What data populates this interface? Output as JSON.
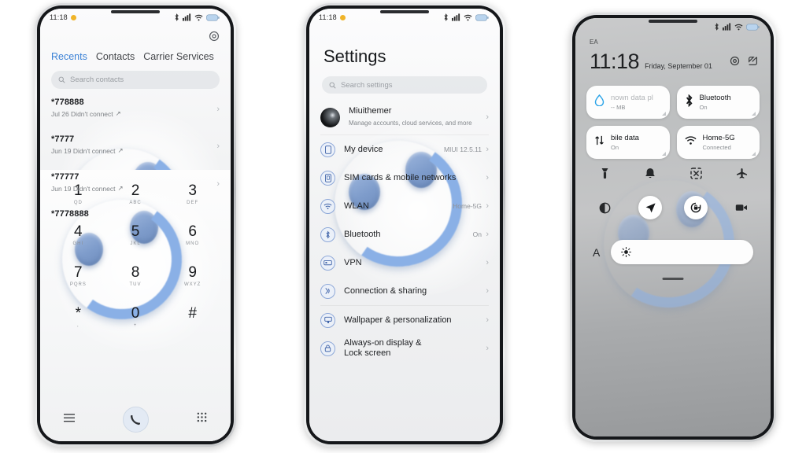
{
  "scene": {
    "background": "#ffffff",
    "accent_blue": "#3b82d6",
    "wallpaper_blue": "#8ab0e6"
  },
  "phone1": {
    "name": "dialer-phone",
    "status_bar": {
      "time": "11:18",
      "icons": [
        "amber-dot-icon",
        "bluetooth-icon",
        "signal-icon",
        "wifi-icon",
        "battery-icon"
      ]
    },
    "settings_icon": "gear-icon",
    "tabs": [
      {
        "label": "Recents",
        "active": true
      },
      {
        "label": "Contacts",
        "active": false
      },
      {
        "label": "Carrier Services",
        "active": false
      }
    ],
    "search": {
      "placeholder": "Search contacts",
      "icon": "search-icon"
    },
    "calls": [
      {
        "number": "*778888",
        "meta": "Jul 26 Didn't connect"
      },
      {
        "number": "*7777",
        "meta": "Jun 19 Didn't connect"
      },
      {
        "number": "*77777",
        "meta": "Jun 19 Didn't connect"
      },
      {
        "number": "*7778888",
        "meta": ""
      }
    ],
    "keypad": [
      {
        "digit": "1",
        "letters": "QD"
      },
      {
        "digit": "2",
        "letters": "ABC"
      },
      {
        "digit": "3",
        "letters": "DEF"
      },
      {
        "digit": "4",
        "letters": "GHI"
      },
      {
        "digit": "5",
        "letters": "JKL"
      },
      {
        "digit": "6",
        "letters": "MNO"
      },
      {
        "digit": "7",
        "letters": "PQRS"
      },
      {
        "digit": "8",
        "letters": "TUV"
      },
      {
        "digit": "9",
        "letters": "WXYZ"
      },
      {
        "digit": "*",
        "letters": ","
      },
      {
        "digit": "0",
        "letters": "+"
      },
      {
        "digit": "#",
        "letters": ""
      }
    ],
    "bottom_bar": {
      "menu_icon": "menu-icon",
      "call_icon": "phone-call-icon",
      "keypad_icon": "keypad-icon"
    }
  },
  "phone2": {
    "name": "settings-phone",
    "status_bar": {
      "time": "11:18",
      "icons": [
        "amber-dot-icon",
        "bluetooth-icon",
        "signal-icon",
        "wifi-icon",
        "battery-icon"
      ]
    },
    "title": "Settings",
    "search": {
      "placeholder": "Search settings",
      "icon": "search-icon"
    },
    "account": {
      "name": "Miuithemer",
      "subtitle": "Manage accounts, cloud services, and more",
      "avatar": "profile-avatar"
    },
    "items": [
      {
        "label": "My device",
        "value": "MIUI 12.5.11",
        "icon": "phone-icon"
      },
      {
        "label": "SIM cards & mobile networks",
        "value": "",
        "icon": "sim-card-icon"
      },
      {
        "label": "WLAN",
        "value": "Home-5G",
        "icon": "wifi-icon"
      },
      {
        "label": "Bluetooth",
        "value": "On",
        "icon": "bluetooth-icon"
      },
      {
        "label": "VPN",
        "value": "",
        "icon": "vpn-icon"
      },
      {
        "label": "Connection & sharing",
        "value": "",
        "icon": "connection-sharing-icon"
      },
      {
        "label": "Wallpaper & personalization",
        "value": "",
        "icon": "wallpaper-icon"
      },
      {
        "label": "Always-on display & Lock screen",
        "value": "",
        "icon": "lock-icon"
      }
    ]
  },
  "phone3": {
    "name": "control-center-phone",
    "carrier": "EA",
    "status_icons": [
      "bluetooth-icon",
      "signal-icon",
      "wifi-icon",
      "battery-icon"
    ],
    "time": "11:18",
    "date": "Friday, September 01",
    "header_icons": [
      "gear-icon",
      "edit-icon"
    ],
    "tiles": [
      {
        "title": "nown data pl",
        "subtitle": "-- MB",
        "icon": "data-drop-icon",
        "state": "off"
      },
      {
        "title": "Bluetooth",
        "subtitle": "On",
        "icon": "bluetooth-icon",
        "state": "on"
      },
      {
        "title": "bile data",
        "subtitle": "On",
        "icon": "mobile-data-icon",
        "state": "on"
      },
      {
        "title": "Home-5G",
        "subtitle": "Connected",
        "icon": "wifi-icon",
        "state": "on"
      }
    ],
    "toggles_row1": [
      {
        "icon": "flashlight-icon",
        "active": false
      },
      {
        "icon": "bell-icon",
        "active": false
      },
      {
        "icon": "screenshot-icon",
        "active": false
      },
      {
        "icon": "airplane-icon",
        "active": false
      }
    ],
    "toggles_row2": [
      {
        "icon": "dark-mode-icon",
        "active": false
      },
      {
        "icon": "location-icon",
        "active": true
      },
      {
        "icon": "rotation-lock-icon",
        "active": true
      },
      {
        "icon": "screen-recorder-icon",
        "active": false
      }
    ],
    "brightness": {
      "auto_label": "A",
      "icon": "brightness-sun-icon",
      "level": 8
    }
  }
}
